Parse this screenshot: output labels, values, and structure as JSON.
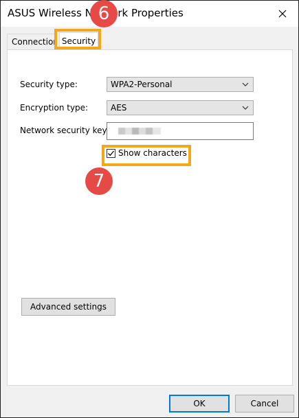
{
  "window": {
    "title": "ASUS Wireless Network Properties"
  },
  "tabs": [
    {
      "label": "Connection",
      "selected": false
    },
    {
      "label": "Security",
      "selected": true
    }
  ],
  "security": {
    "security_type_label": "Security type:",
    "security_type_value": "WPA2-Personal",
    "encryption_type_label": "Encryption type:",
    "encryption_type_value": "AES",
    "network_key_label": "Network security key",
    "show_characters_label": "Show characters",
    "show_characters_checked": true,
    "advanced_button": "Advanced settings"
  },
  "footer": {
    "ok_label": "OK",
    "cancel_label": "Cancel"
  },
  "annotations": {
    "step_tab": "6",
    "step_checkbox": "7",
    "highlight_color": "#f3a81c",
    "badge_color": "#e64a47"
  },
  "icons": {
    "close": "close-icon",
    "dropdown": "chevron-down-icon",
    "check": "check-icon"
  }
}
